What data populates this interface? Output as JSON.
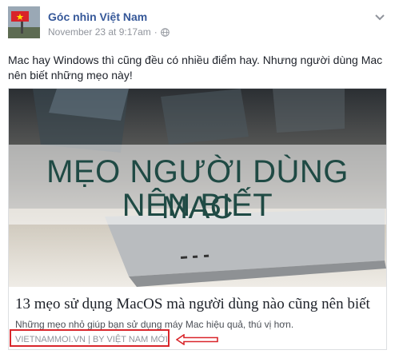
{
  "post": {
    "page_name": "Góc nhìn Việt Nam",
    "timestamp": "November 23 at 9:17am",
    "separator": "·",
    "privacy_icon": "globe-icon",
    "options_icon": "chevron-down-icon",
    "text": "Mac hay Windows thì cũng đều có nhiều điểm hay. Nhưng người dùng Mac nên biết những mẹo này!"
  },
  "link_preview": {
    "image_line1": "MẸO NGƯỜI DÙNG MAC",
    "image_line2": "NÊN BIẾT",
    "title": "13 mẹo sử dụng MacOS mà người dùng nào cũng nên biết",
    "description": "Những mẹo nhỏ giúp bạn sử dụng máy Mac hiệu quả, thú vị hơn.",
    "source": "VIETNAMMOI.VN | BY VIỆT NAM MỚI"
  },
  "annotation": {
    "box_color": "#d9262b",
    "arrow_color": "#d9262b"
  },
  "colors": {
    "link_blue": "#365899",
    "meta_gray": "#90949c",
    "text": "#1d2129"
  }
}
